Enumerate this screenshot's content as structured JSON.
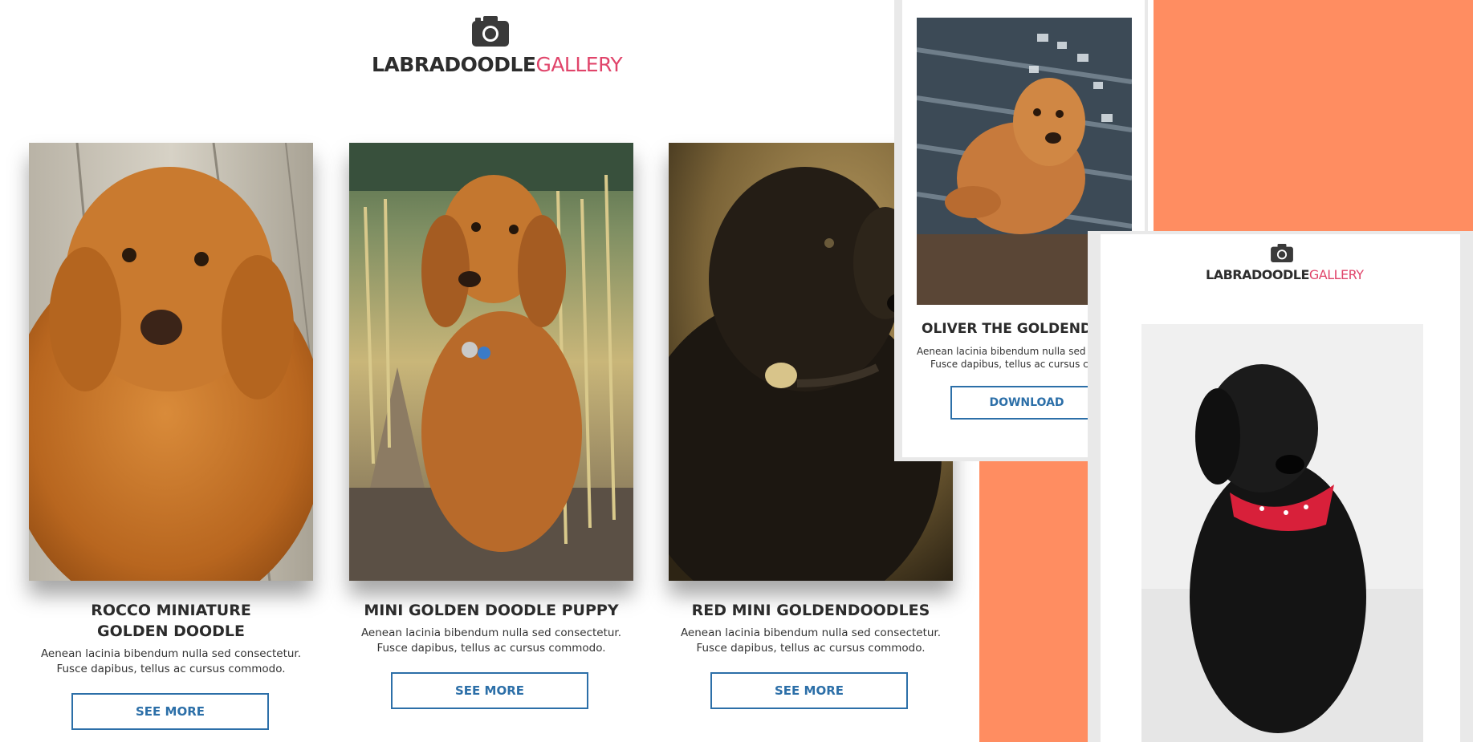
{
  "logo": {
    "part1": "LABRADOODLE",
    "part2": "GALLERY"
  },
  "colors": {
    "accent": "#e0446a",
    "button": "#2c6fa8",
    "backdrop": "#ff8d61"
  },
  "gallery": [
    {
      "title": "ROCCO MINIATURE GOLDEN DOODLE",
      "text": "Aenean lacinia bibendum nulla sed consectetur. Fusce dapibus, tellus ac cursus commodo.",
      "button": "SEE MORE"
    },
    {
      "title": "MINI GOLDEN DOODLE PUPPY",
      "text": "Aenean lacinia bibendum nulla sed consectetur. Fusce dapibus, tellus ac cursus commodo.",
      "button": "SEE MORE"
    },
    {
      "title": "RED MINI GOLDENDOODLES",
      "text": "Aenean lacinia bibendum nulla sed consectetur. Fusce dapibus, tellus ac cursus commodo.",
      "button": "SEE MORE"
    }
  ],
  "detail": {
    "title": "OLIVER THE GOLDENDO",
    "text_line1": "Aenean lacinia bibendum nulla sed co",
    "text_line2": "Fusce dapibus, tellus ac cursus com",
    "button": "DOWNLOAD"
  },
  "mobile": {
    "logo_part1": "LABRADOODLE",
    "logo_part2": "GALLERY"
  },
  "icons": [
    "camera-icon"
  ]
}
